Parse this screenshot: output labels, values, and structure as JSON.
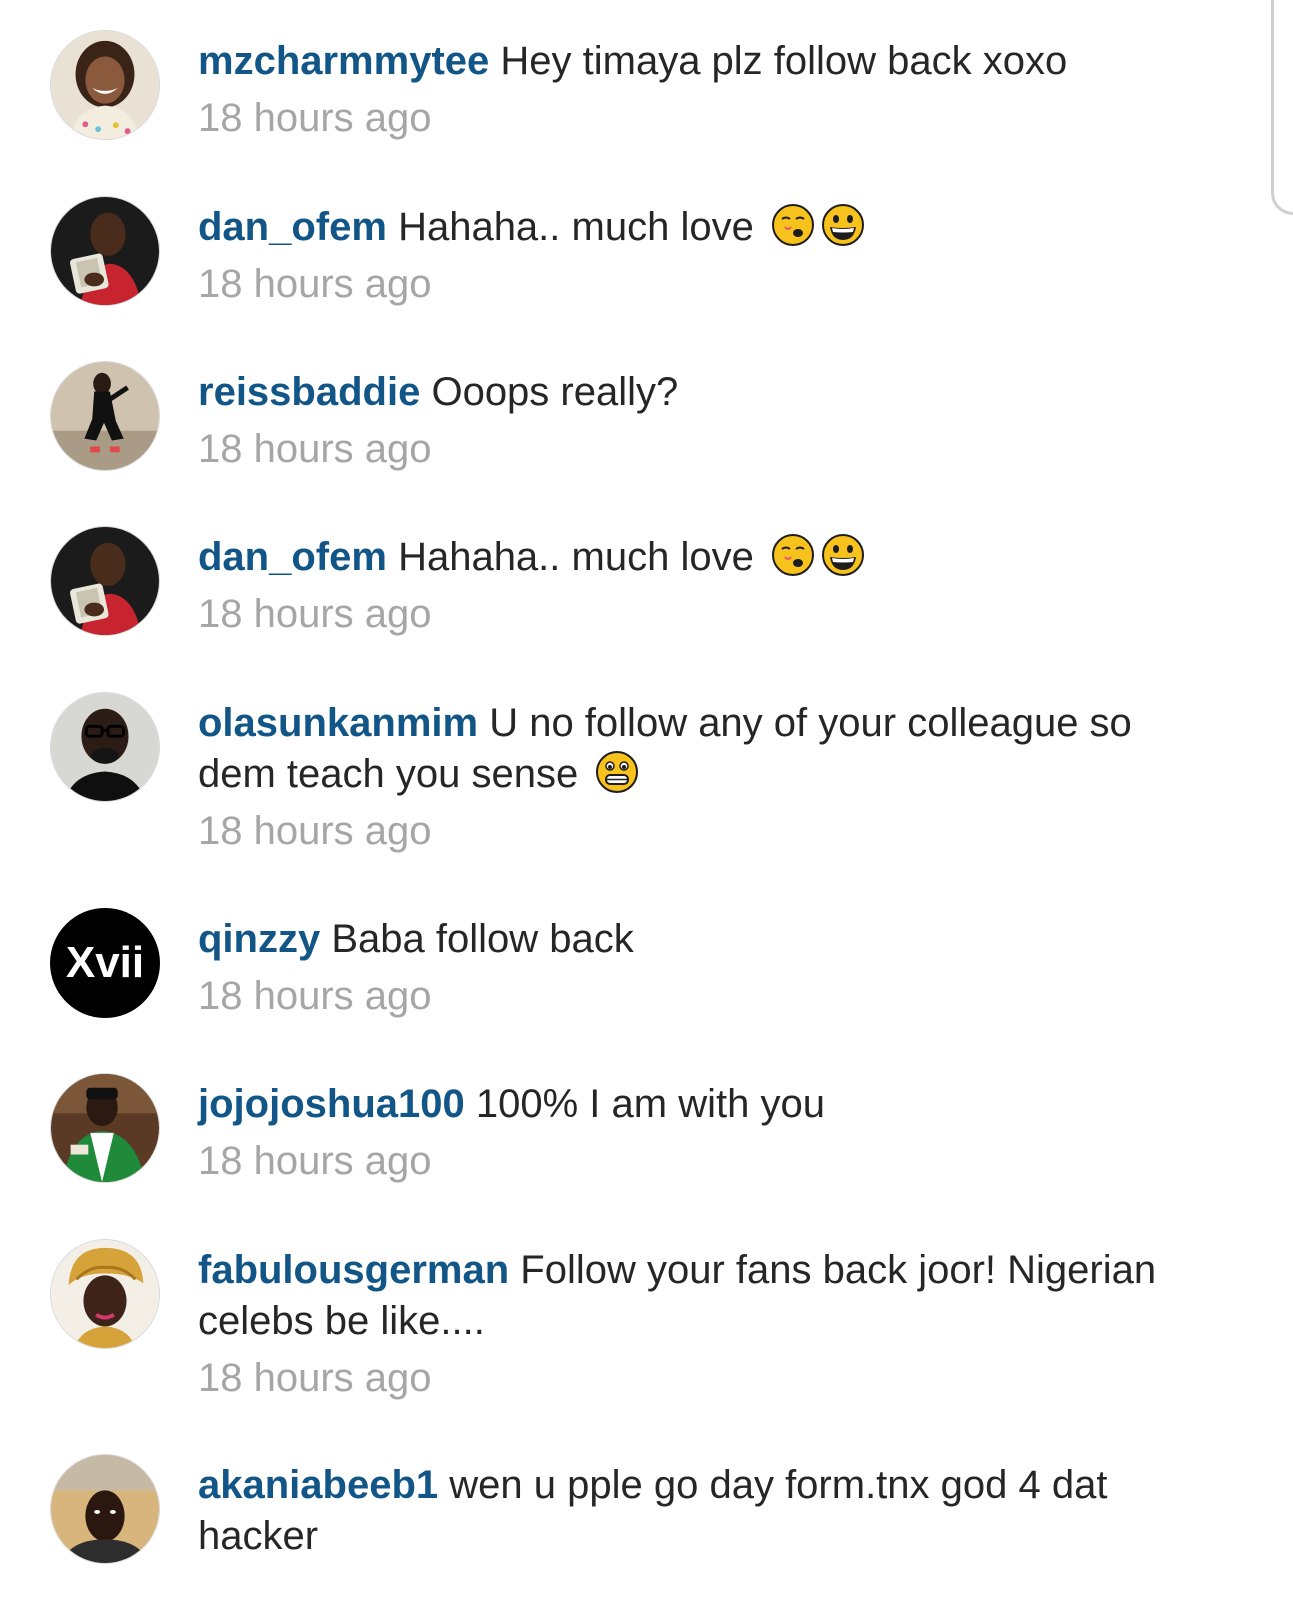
{
  "comments": [
    {
      "username": "mzcharmmytee",
      "text": "Hey timaya plz follow back xoxo",
      "time": "18 hours ago",
      "avatar": "photo-woman-smiling",
      "emoji": []
    },
    {
      "username": "dan_ofem",
      "text": "Hahaha.. much love",
      "time": "18 hours ago",
      "avatar": "photo-man-with-cash",
      "emoji": [
        "winking-kiss-emoji",
        "grinning-emoji"
      ]
    },
    {
      "username": "reissbaddie",
      "text": "Ooops really?",
      "time": "18 hours ago",
      "avatar": "photo-woman-crouching",
      "emoji": []
    },
    {
      "username": "dan_ofem",
      "text": "Hahaha.. much love",
      "time": "18 hours ago",
      "avatar": "photo-man-with-cash",
      "emoji": [
        "winking-kiss-emoji",
        "grinning-emoji"
      ]
    },
    {
      "username": "olasunkanmim",
      "text": "U no follow any of your colleague so dem teach you sense",
      "time": "18 hours ago",
      "avatar": "photo-man-glasses",
      "emoji": [
        "grimacing-emoji"
      ]
    },
    {
      "username": "qinzzy",
      "text": "Baba follow back",
      "time": "18 hours ago",
      "avatar_text": "Xvii",
      "emoji": []
    },
    {
      "username": "jojojoshua100",
      "text": "100% I am with you",
      "time": "18 hours ago",
      "avatar": "photo-man-green-jersey",
      "emoji": []
    },
    {
      "username": "fabulousgerman",
      "text": "Follow your fans back joor! Nigerian celebs be like....",
      "time": "18 hours ago",
      "avatar": "photo-woman-headwrap",
      "emoji": []
    },
    {
      "username": "akaniabeeb1",
      "text": "wen u pple go day form.tnx god 4 dat hacker",
      "time": "",
      "avatar": "photo-man-outdoors",
      "emoji": []
    }
  ],
  "colors": {
    "username": "#125688",
    "text": "#262626",
    "timestamp": "#a6a6a6",
    "background": "#ffffff"
  }
}
